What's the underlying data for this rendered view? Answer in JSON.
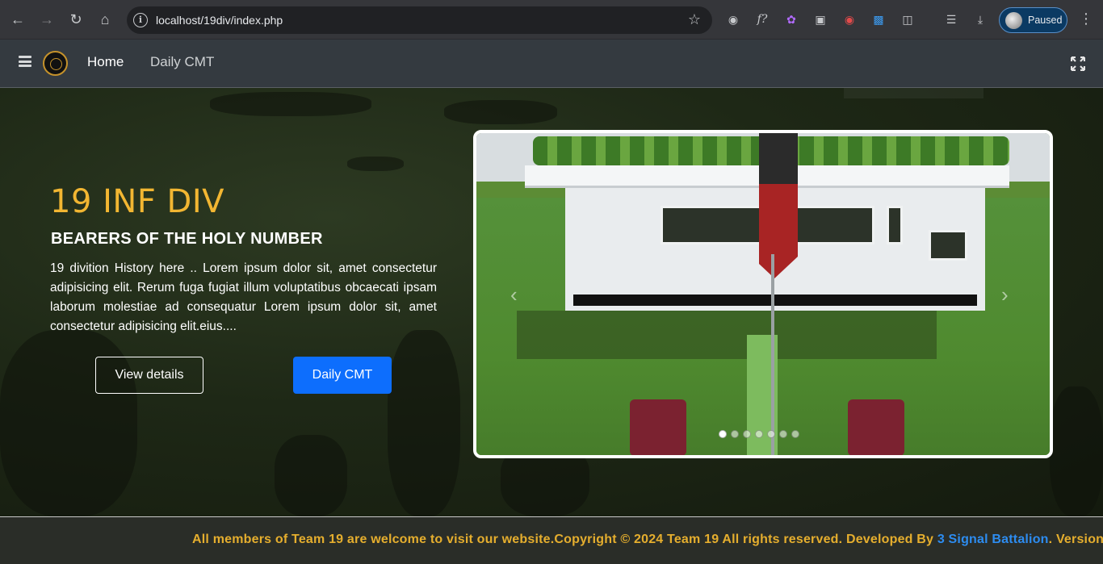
{
  "browser": {
    "url": "localhost/19div/index.php",
    "profile_status": "Paused"
  },
  "navbar": {
    "links": [
      {
        "label": "Home",
        "active": true
      },
      {
        "label": "Daily CMT",
        "active": false
      }
    ]
  },
  "hero": {
    "title": "19 INF DIV",
    "subtitle": "BEARERS OF THE HOLY NUMBER",
    "text": "19 divition History here .. Lorem ipsum dolor sit, amet consectetur adipisicing elit. Rerum fuga fugiat illum voluptatibus obcaecati ipsam laborum molestiae ad consequatur Lorem ipsum dolor sit, amet consectetur adipisicing elit.eius....",
    "buttons": {
      "details_label": "View details",
      "cmt_label": "Daily CMT"
    },
    "carousel": {
      "slide_count": 7,
      "active_index": 0
    }
  },
  "footer": {
    "text": "All members of Team 19 are welcome to visit our website.Copyright © 2024 Team 19 All rights reserved. Developed By ",
    "developer": "3 Signal Battalion",
    "suffix": ". Version"
  },
  "colors": {
    "title_gold": "#f2b632",
    "primary_blue": "#0d6efd",
    "footer_text": "#e5ae2e",
    "developer_link": "#2d8cf0"
  }
}
